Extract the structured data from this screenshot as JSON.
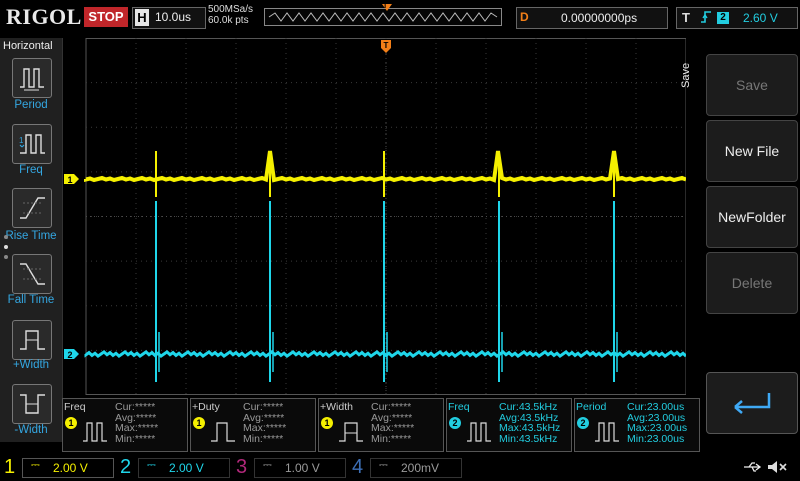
{
  "header": {
    "brand": "RIGOL",
    "run_state": "STOP",
    "timebase_label": "H",
    "timebase_value": "10.0us",
    "sample_rate": "500MSa/s",
    "memory_points": "60.0k pts",
    "trigger_marker": "T",
    "delay_label": "D",
    "delay_value": "0.00000000ps",
    "trigger_label": "T",
    "trigger_edge": "rising-edge-icon",
    "trigger_source": "2",
    "trigger_level": "2.60 V"
  },
  "left_menu": {
    "title": "Horizontal",
    "items": [
      {
        "label": "Period",
        "icon": "period-icon"
      },
      {
        "label": "Freq",
        "icon": "freq-icon"
      },
      {
        "label": "Rise Time",
        "icon": "rise-time-icon"
      },
      {
        "label": "Fall Time",
        "icon": "fall-time-icon"
      },
      {
        "label": "+Width",
        "icon": "pos-width-icon"
      },
      {
        "label": "-Width",
        "icon": "neg-width-icon"
      }
    ]
  },
  "right_menu": {
    "title": "Save",
    "buttons": [
      {
        "label": "Save",
        "enabled": false
      },
      {
        "label": "New File",
        "enabled": true
      },
      {
        "label": "NewFolder",
        "enabled": true
      },
      {
        "label": "Delete",
        "enabled": false
      }
    ],
    "enter_icon": "enter-icon"
  },
  "waveform": {
    "ch1_marker": "1",
    "ch2_marker": "2",
    "ch1_color": "#f5f000",
    "ch2_color": "#1fd6ea",
    "trigger_color": "#f27f18"
  },
  "measurements": [
    {
      "name": "Freq",
      "channel": "1",
      "rows": [
        "Cur:*****",
        "Avg:*****",
        "Max:*****",
        "Min:*****"
      ]
    },
    {
      "name": "+Duty",
      "channel": "1",
      "rows": [
        "Cur:*****",
        "Avg:*****",
        "Max:*****",
        "Min:*****"
      ]
    },
    {
      "name": "+Width",
      "channel": "1",
      "rows": [
        "Cur:*****",
        "Avg:*****",
        "Max:*****",
        "Min:*****"
      ]
    },
    {
      "name": "Freq",
      "channel": "2",
      "rows": [
        "Cur:43.5kHz",
        "Avg:43.5kHz",
        "Max:43.5kHz",
        "Min:43.5kHz"
      ]
    },
    {
      "name": "Period",
      "channel": "2",
      "rows": [
        "Cur:23.00us",
        "Avg:23.00us",
        "Max:23.00us",
        "Min:23.00us"
      ]
    }
  ],
  "channels": [
    {
      "num": "1",
      "scale": "2.00 V",
      "color": "#f5f000",
      "active": true
    },
    {
      "num": "2",
      "scale": "2.00 V",
      "color": "#1fd6ea",
      "active": true
    },
    {
      "num": "3",
      "scale": "1.00 V",
      "color": "#b0287a",
      "active": false
    },
    {
      "num": "4",
      "scale": "200mV",
      "color": "#3d6fb6",
      "active": false
    }
  ],
  "status_icons": {
    "usb": "usb-icon",
    "sound": "speaker-mute-icon"
  }
}
